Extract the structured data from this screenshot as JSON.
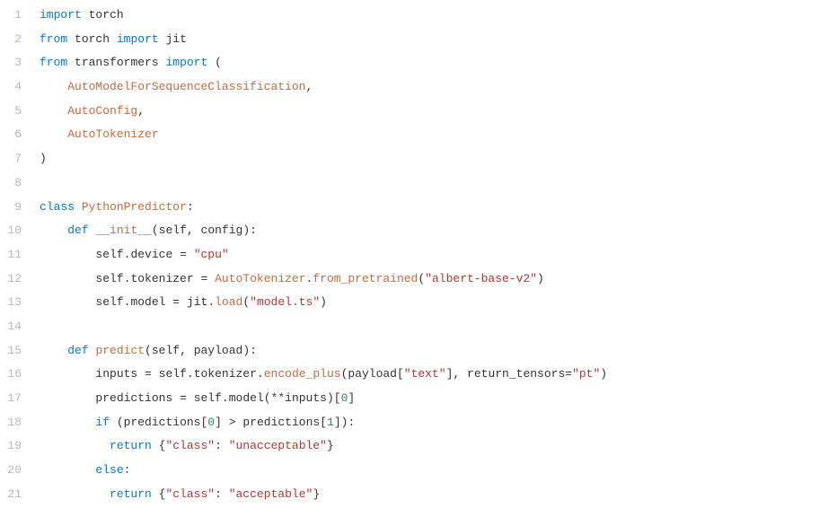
{
  "lines": {
    "n1": "1",
    "n2": "2",
    "n3": "3",
    "n4": "4",
    "n5": "5",
    "n6": "6",
    "n7": "7",
    "n8": "8",
    "n9": "9",
    "n10": "10",
    "n11": "11",
    "n12": "12",
    "n13": "13",
    "n14": "14",
    "n15": "15",
    "n16": "16",
    "n17": "17",
    "n18": "18",
    "n19": "19",
    "n20": "20",
    "n21": "21"
  },
  "tok": {
    "kw_import": "import",
    "kw_from": "from",
    "kw_class": "class",
    "kw_def": "def",
    "kw_if": "if",
    "kw_else": "else",
    "kw_return": "return",
    "mod_torch": "torch",
    "mod_jit": "jit",
    "mod_transformers": "transformers",
    "cls_automodel": "AutoModelForSequenceClassification",
    "cls_autoconfig": "AutoConfig",
    "cls_autotokenizer": "AutoTokenizer",
    "cls_pythonpredictor": "PythonPredictor",
    "fn_init": "__init__",
    "fn_predict": "predict",
    "fn_from_pretrained": "from_pretrained",
    "fn_load": "load",
    "fn_encode_plus": "encode_plus",
    "id_self": "self",
    "id_config": "config",
    "id_device": "device",
    "id_tokenizer": "tokenizer",
    "id_model": "model",
    "id_payload": "payload",
    "id_inputs": "inputs",
    "id_predictions": "predictions",
    "id_return_tensors": "return_tensors",
    "str_cpu": "\"cpu\"",
    "str_albert": "\"albert-base-v2\"",
    "str_modelts": "\"model.ts\"",
    "str_text": "\"text\"",
    "str_pt": "\"pt\"",
    "str_class": "\"class\"",
    "str_unacceptable": "\"unacceptable\"",
    "str_acceptable": "\"acceptable\"",
    "num_0": "0",
    "num_1": "1",
    "lparen": "(",
    "rparen": ")",
    "lbrace": "{",
    "rbrace": "}",
    "lbrack": "[",
    "rbrack": "]",
    "comma": ",",
    "colon": ":",
    "dot": ".",
    "eq": "=",
    "gt": ">",
    "star": "**"
  }
}
